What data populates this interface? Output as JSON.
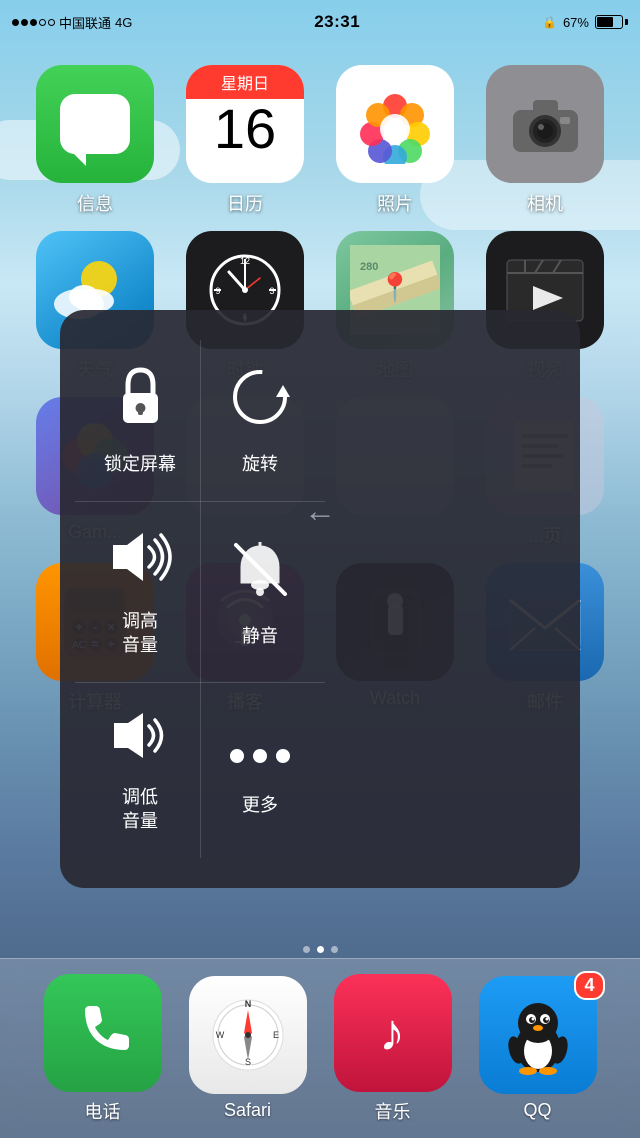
{
  "statusBar": {
    "carrier": "中国联通",
    "network": "4G",
    "time": "23:31",
    "battery": "67%",
    "dots": [
      "filled",
      "filled",
      "filled",
      "empty",
      "empty"
    ]
  },
  "apps": {
    "row1": [
      {
        "id": "messages",
        "label": "信息",
        "type": "messages"
      },
      {
        "id": "calendar",
        "label": "日历",
        "type": "calendar",
        "calDay": "星期日",
        "calDate": "16"
      },
      {
        "id": "photos",
        "label": "照片",
        "type": "photos"
      },
      {
        "id": "camera",
        "label": "相机",
        "type": "camera"
      }
    ],
    "row2": [
      {
        "id": "weather",
        "label": "天气",
        "type": "weather"
      },
      {
        "id": "clock",
        "label": "时钟",
        "type": "clock"
      },
      {
        "id": "maps",
        "label": "地图",
        "type": "maps"
      },
      {
        "id": "videos",
        "label": "视频",
        "type": "videos"
      }
    ],
    "row3": [
      {
        "id": "gamecenter",
        "label": "Gam...",
        "type": "gamecenter"
      },
      {
        "id": "blank1",
        "label": "",
        "type": "blank"
      },
      {
        "id": "blank2",
        "label": "",
        "type": "blank"
      },
      {
        "id": "page",
        "label": "...页",
        "type": "page"
      }
    ],
    "row4": [
      {
        "id": "calculator",
        "label": "计算器",
        "type": "calc"
      },
      {
        "id": "podcasts",
        "label": "播客",
        "type": "podcasts"
      },
      {
        "id": "watch",
        "label": "Watch",
        "type": "watch"
      },
      {
        "id": "mail",
        "label": "邮件",
        "type": "mail"
      }
    ]
  },
  "dock": [
    {
      "id": "phone",
      "label": "电话",
      "type": "phone"
    },
    {
      "id": "safari",
      "label": "Safari",
      "type": "safari"
    },
    {
      "id": "music",
      "label": "音乐",
      "type": "music"
    },
    {
      "id": "qq",
      "label": "QQ",
      "type": "qq",
      "badge": "4"
    }
  ],
  "assistiveMenu": {
    "items": [
      {
        "id": "lock-screen",
        "label": "锁定屏幕",
        "icon": "lock"
      },
      {
        "id": "rotate",
        "label": "旋转",
        "icon": "rotate"
      },
      {
        "id": "volume-up",
        "label": "调高\n音量",
        "icon": "volume-up"
      },
      {
        "id": "mute",
        "label": "静音",
        "icon": "mute"
      },
      {
        "id": "volume-down",
        "label": "调低\n音量",
        "icon": "volume-down"
      },
      {
        "id": "more",
        "label": "更多",
        "icon": "more"
      }
    ],
    "centerArrow": "←"
  },
  "pageIndicator": {
    "dots": [
      false,
      true,
      false
    ]
  }
}
